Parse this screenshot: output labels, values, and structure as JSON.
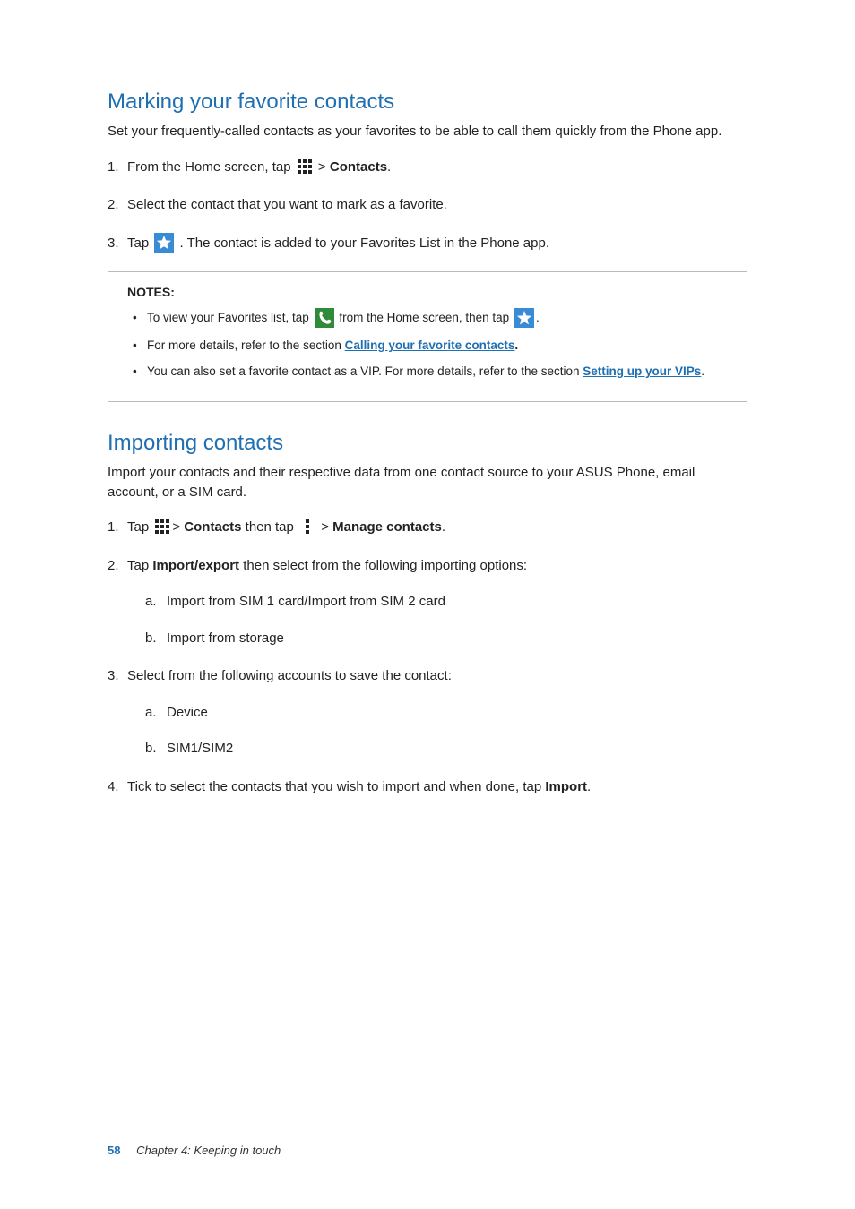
{
  "section1": {
    "heading": "Marking your favorite contacts",
    "intro": "Set your frequently-called contacts as your favorites to be able to call them quickly from the Phone app.",
    "step1_a": "From the Home screen, tap ",
    "step1_b": "  > ",
    "step1_c": "Contacts",
    "step1_d": ".",
    "step2": "Select the contact that you want to mark as a favorite.",
    "step3_a": "Tap ",
    "step3_b": ". The contact is added to your Favorites List in the Phone app."
  },
  "notes": {
    "title": "NOTES:",
    "n1_a": "To view your Favorites list, tap ",
    "n1_b": " from the Home screen, then tap ",
    "n1_c": ".",
    "n2_a": "For more details, refer to the section ",
    "n2_link": "Calling your favorite contacts",
    "n2_b": ".",
    "n3_a": "You can also set a favorite contact as a VIP. For more details, refer to the section ",
    "n3_link": "Setting up your VIPs",
    "n3_b": "."
  },
  "section2": {
    "heading": "Importing contacts",
    "intro": "Import your contacts and their respective data from one contact source to your ASUS Phone, email account, or a SIM card.",
    "step1_a": "Tap ",
    "step1_b": "> ",
    "step1_c": "Contacts",
    "step1_d": " then tap ",
    "step1_e": " > ",
    "step1_f": "Manage contacts",
    "step1_g": ".",
    "step2_a": "Tap ",
    "step2_b": "Import/export",
    "step2_c": " then select from the following importing options:",
    "step2_sub_a": "Import from SIM 1 card/Import from SIM 2 card",
    "step2_sub_b": "Import from storage",
    "step3": "Select from the following accounts to save the contact:",
    "step3_sub_a": "Device",
    "step3_sub_b": "SIM1/SIM2",
    "step4_a": "Tick to select the contacts that you wish to import and when done, tap ",
    "step4_b": "Import",
    "step4_c": "."
  },
  "footer": {
    "page": "58",
    "chapter": "Chapter 4:  Keeping in touch"
  }
}
